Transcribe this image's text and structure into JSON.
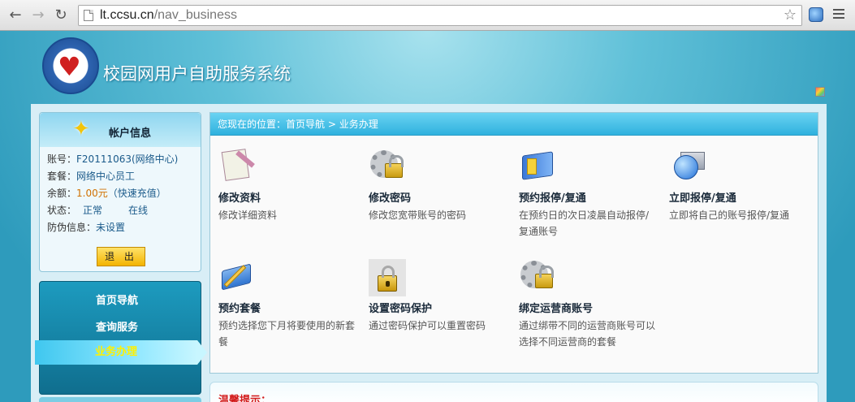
{
  "browser": {
    "url_host": "lt.ccsu.cn",
    "url_path": "/nav_business"
  },
  "header": {
    "site_title": "校园网用户自助服务系统"
  },
  "account": {
    "title": "帐户信息",
    "rows": [
      {
        "label": "账号：",
        "value": "F20111063(网络中心)"
      },
      {
        "label": "套餐：",
        "value": "网络中心员工"
      },
      {
        "label": "余额：",
        "value": "1.00元",
        "extra": "（快速充值）"
      },
      {
        "label": "状态：",
        "value": "正常",
        "extra": "在线"
      },
      {
        "label": "防伪信息：",
        "value": "未设置"
      }
    ],
    "logout_label": "退 出"
  },
  "nav": {
    "items": [
      {
        "label": "首页导航"
      },
      {
        "label": "查询服务"
      },
      {
        "label": "业务办理"
      }
    ],
    "active_index": 2
  },
  "breadcrumb": {
    "prefix": "您现在的位置：",
    "home": "首页导航",
    "sep": ">",
    "current": "业务办理"
  },
  "services": [
    {
      "name": "修改资料",
      "desc": "修改详细资料",
      "icon": "edit-profile-icon"
    },
    {
      "name": "修改密码",
      "desc": "修改您宽带账号的密码",
      "icon": "gear-lock-icon"
    },
    {
      "name": "预约报停/复通",
      "desc": "在预约日的次日凌晨自动报停/复通账号",
      "icon": "book-schedule-icon"
    },
    {
      "name": "立即报停/复通",
      "desc": "立即将自己的账号报停/复通",
      "icon": "globe-folder-icon"
    },
    {
      "name": "预约套餐",
      "desc": "预约选择您下月将要使用的新套餐",
      "icon": "pen-book-icon"
    },
    {
      "name": "设置密码保护",
      "desc": "通过密码保护可以重置密码",
      "icon": "padlock-icon"
    },
    {
      "name": "绑定运营商账号",
      "desc": "通过绑带不同的运营商账号可以选择不同运营商的套餐",
      "icon": "gear-lock-icon"
    }
  ],
  "tips": {
    "title": "温馨提示："
  },
  "colors": {
    "accent": "#2fb1de",
    "active_nav_text": "#fff100",
    "balance": "#d07000",
    "tips_title": "#d21a1a"
  }
}
